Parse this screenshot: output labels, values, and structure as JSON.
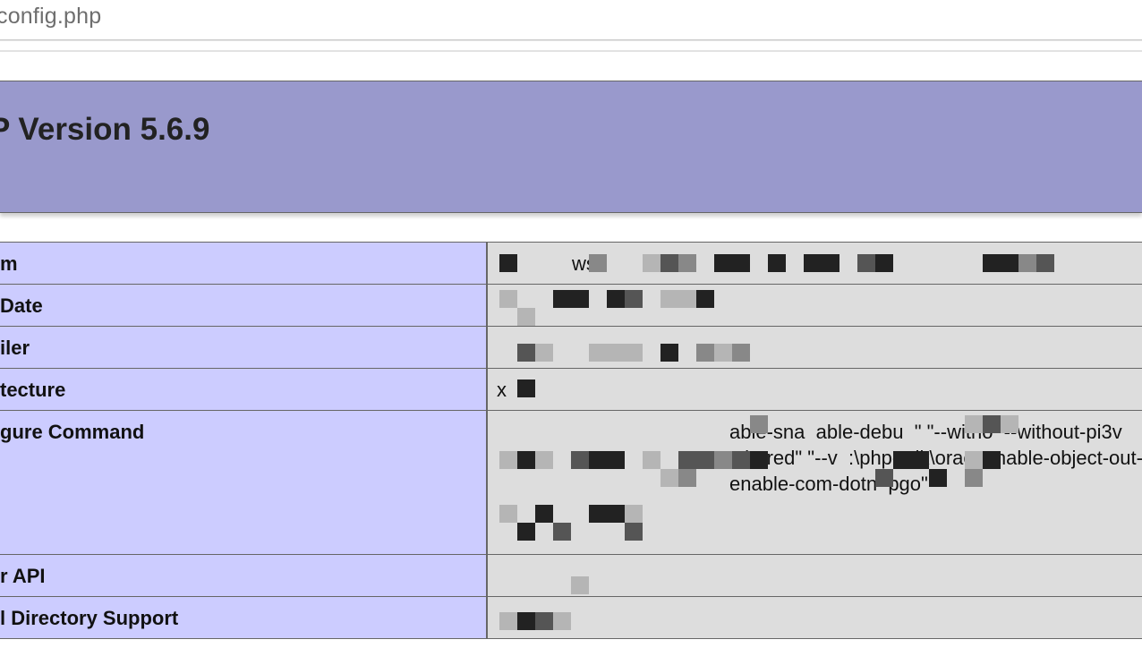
{
  "address_bar": {
    "url": "config.php"
  },
  "header": {
    "title": "P Version 5.6.9"
  },
  "info_rows": [
    {
      "label": "m",
      "value": "ws"
    },
    {
      "label": "Date",
      "value": ""
    },
    {
      "label": "iler",
      "value": ""
    },
    {
      "label": "tecture",
      "value": "x"
    },
    {
      "label": "gure Command",
      "value": "able-sna  able-debu  \" \"--witho  --without-pi3v  ,shared\" \"--v  :\\php-sdk\\orac  enable-object-out-  enable-com-dotn  pgo\""
    },
    {
      "label": "r API",
      "value": ""
    },
    {
      "label": "l Directory Support",
      "value": ""
    }
  ],
  "colors": {
    "header_bg": "#9999cc",
    "label_bg": "#ccccff",
    "value_bg": "#dddddd"
  }
}
